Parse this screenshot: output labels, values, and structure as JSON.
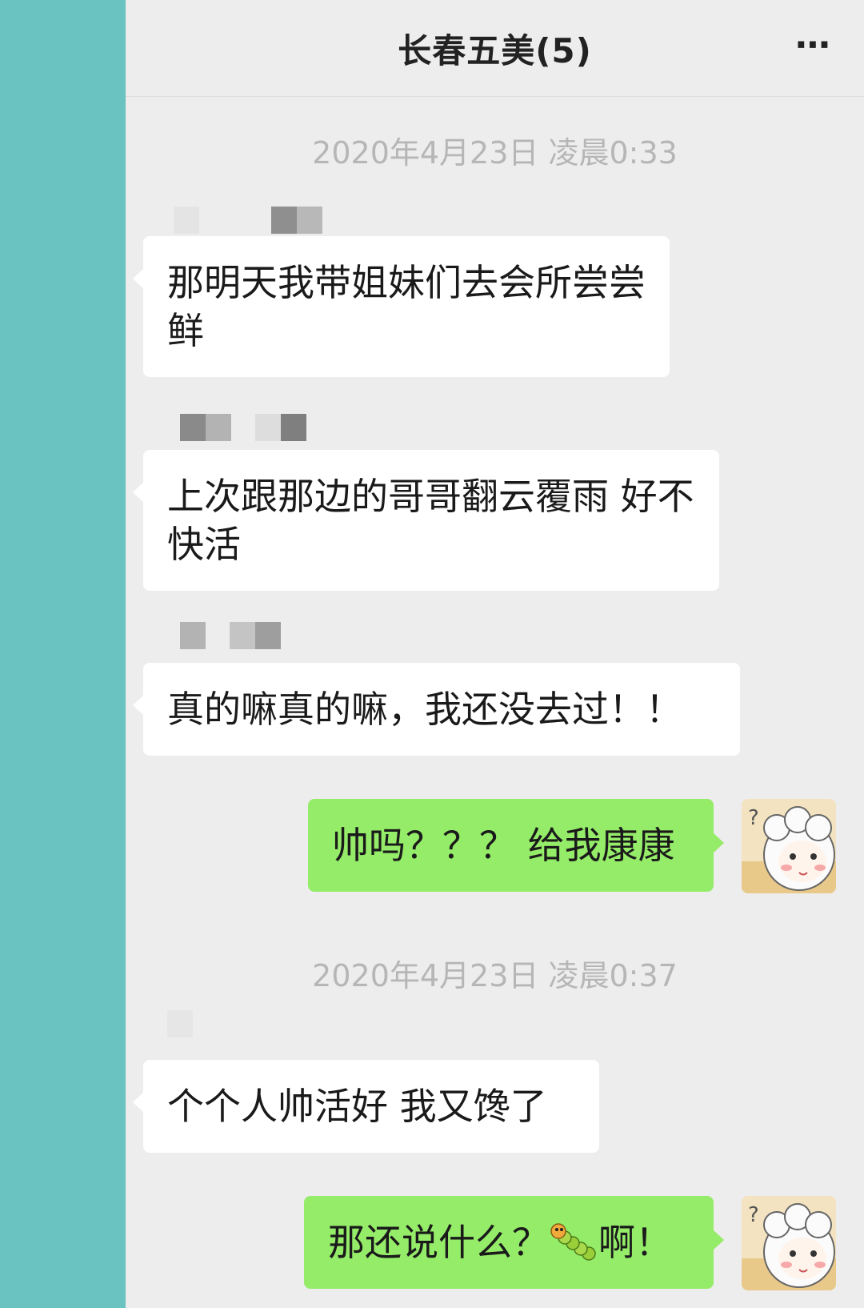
{
  "header": {
    "title": "长春五美(5)",
    "more_icon": "⋯"
  },
  "timestamps": [
    "2020年4月23日 凌晨0:33",
    "2020年4月23日 凌晨0:37"
  ],
  "messages": [
    {
      "direction": "in",
      "text": "那明天我带姐妹们去会所尝尝鲜"
    },
    {
      "direction": "in",
      "text": "上次跟那边的哥哥翻云覆雨 好不快活"
    },
    {
      "direction": "in",
      "text": "真的嘛真的嘛，我还没去过！！"
    },
    {
      "direction": "out",
      "text": "帅吗？？？ 给我康康"
    },
    {
      "direction": "in",
      "text": "个个人帅活好 我又馋了"
    },
    {
      "direction": "out",
      "text_before": "那还说什么？",
      "emoji": "caterpillar",
      "text_after": "啊！"
    }
  ],
  "colors": {
    "left_strip": "#6bc3c1",
    "background": "#ededed",
    "outgoing_bubble": "#95ec69",
    "incoming_bubble": "#ffffff",
    "timestamp": "#b6b6b6"
  },
  "icons": {
    "more": "more-icon",
    "avatar": "lamb-cartoon-avatar",
    "emoji": "caterpillar-emoji"
  }
}
